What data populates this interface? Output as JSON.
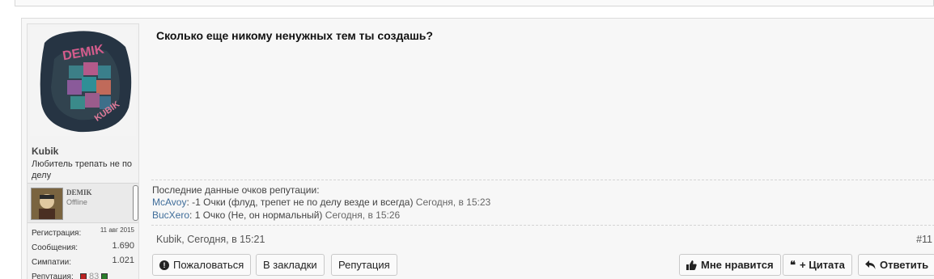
{
  "post": {
    "message": "Сколько еще никому ненужных тем ты создашь?",
    "author": {
      "username": "Kubik",
      "title": "Любитель трепать не по делу",
      "avatar_text": [
        "DEMIK",
        "KUBIK"
      ],
      "mini": {
        "name": "DEMIK",
        "status": "Offline"
      },
      "stats": [
        {
          "key": "Регистрация:",
          "value": "11 авг 2015"
        },
        {
          "key": "Сообщения:",
          "value": "1.690"
        },
        {
          "key": "Симпатии:",
          "value": "1.021"
        },
        {
          "key": "Репутация:",
          "value": "83"
        }
      ]
    },
    "reputation": {
      "title": "Последние данные очков репутации:",
      "entries": [
        {
          "user": "McAvoy",
          "text": ": -1 Очки (флуд, трепет не по делу везде и всегда)",
          "time": "Сегодня, в 15:23"
        },
        {
          "user": "BucXero",
          "text": ": 1 Очко (Не, он нормальный)",
          "time": "Сегодня, в 15:26"
        }
      ]
    },
    "meta": "Kubik, Сегодня, в 15:21",
    "number": "#11",
    "actions_left": [
      {
        "label": "Пожаловаться",
        "icon": "report-icon"
      },
      {
        "label": "В закладки"
      },
      {
        "label": "Репутация"
      }
    ],
    "actions_right": [
      {
        "label": "Мне нравится",
        "icon": "thumbs-up-icon"
      },
      {
        "label": "+ Цитата",
        "icon": "quote-icon"
      },
      {
        "label": "Ответить",
        "icon": "reply-icon"
      }
    ]
  },
  "colors": {
    "link": "#3f6d9a",
    "rep_negative": "#b22222",
    "rep_positive": "#2a7d2a"
  }
}
